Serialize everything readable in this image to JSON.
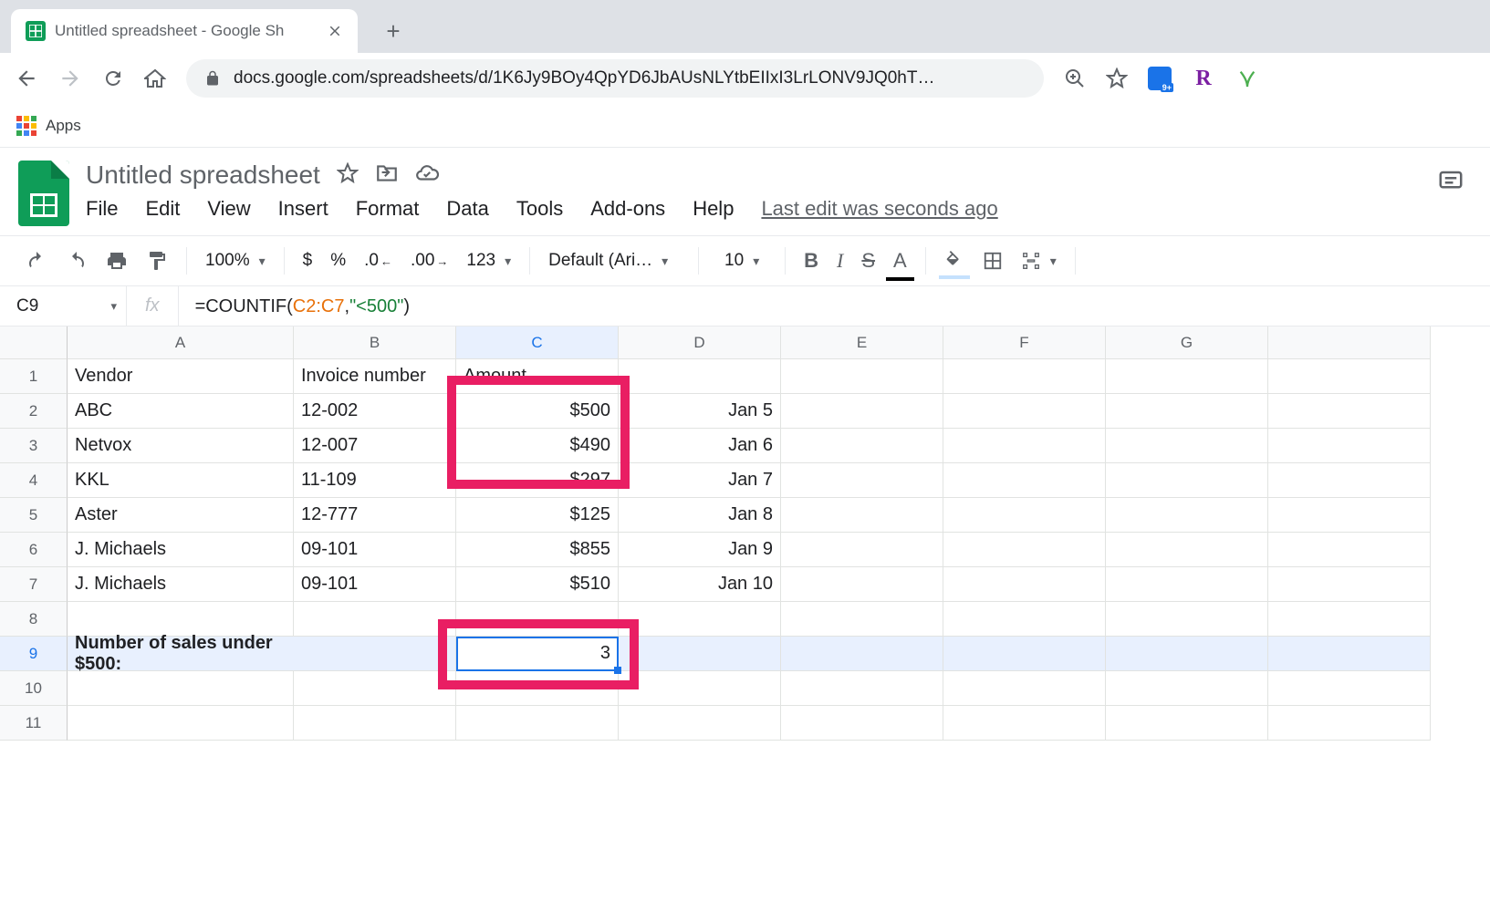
{
  "browser": {
    "tab_title": "Untitled spreadsheet - Google Sh",
    "url": "docs.google.com/spreadsheets/d/1K6Jy9BOy4QpYD6JbAUsNLYtbEIIxI3LrLONV9JQ0hT…",
    "bookmarks_apps": "Apps"
  },
  "doc": {
    "title": "Untitled spreadsheet",
    "menus": [
      "File",
      "Edit",
      "View",
      "Insert",
      "Format",
      "Data",
      "Tools",
      "Add-ons",
      "Help"
    ],
    "last_edit": "Last edit was seconds ago"
  },
  "toolbar": {
    "zoom": "100%",
    "currency": "$",
    "percent": "%",
    "dec_dec": ".0",
    "inc_dec": ".00",
    "num_format": "123",
    "font": "Default (Ari…",
    "font_size": "10",
    "bold": "B",
    "italic": "I",
    "strike": "S",
    "textcolor": "A"
  },
  "formula_bar": {
    "name_box": "C9",
    "fx": "fx",
    "f_prefix": "=COUNTIF",
    "f_open": "(",
    "f_ref": "C2:C7",
    "f_comma": ",",
    "f_str": "\"<500\"",
    "f_close": ")"
  },
  "grid": {
    "cols": [
      "A",
      "B",
      "C",
      "D",
      "E",
      "F",
      "G"
    ],
    "rows": [
      "1",
      "2",
      "3",
      "4",
      "5",
      "6",
      "7",
      "8",
      "9",
      "10",
      "11"
    ],
    "data": {
      "A1": "Vendor",
      "B1": "Invoice number",
      "C1": "Amount",
      "D1": "",
      "A2": "ABC",
      "B2": "12-002",
      "C2": "$500",
      "D2": "Jan 5",
      "A3": "Netvox",
      "B3": "12-007",
      "C3": "$490",
      "D3": "Jan 6",
      "A4": "KKL",
      "B4": "11-109",
      "C4": "$297",
      "D4": "Jan 7",
      "A5": "Aster",
      "B5": "12-777",
      "C5": "$125",
      "D5": "Jan 8",
      "A6": "J. Michaels",
      "B6": "09-101",
      "C6": "$855",
      "D6": "Jan 9",
      "A7": "J. Michaels",
      "B7": "09-101",
      "C7": "$510",
      "D7": "Jan 10",
      "A9": "Number of sales under $500:",
      "C9": "3"
    }
  }
}
